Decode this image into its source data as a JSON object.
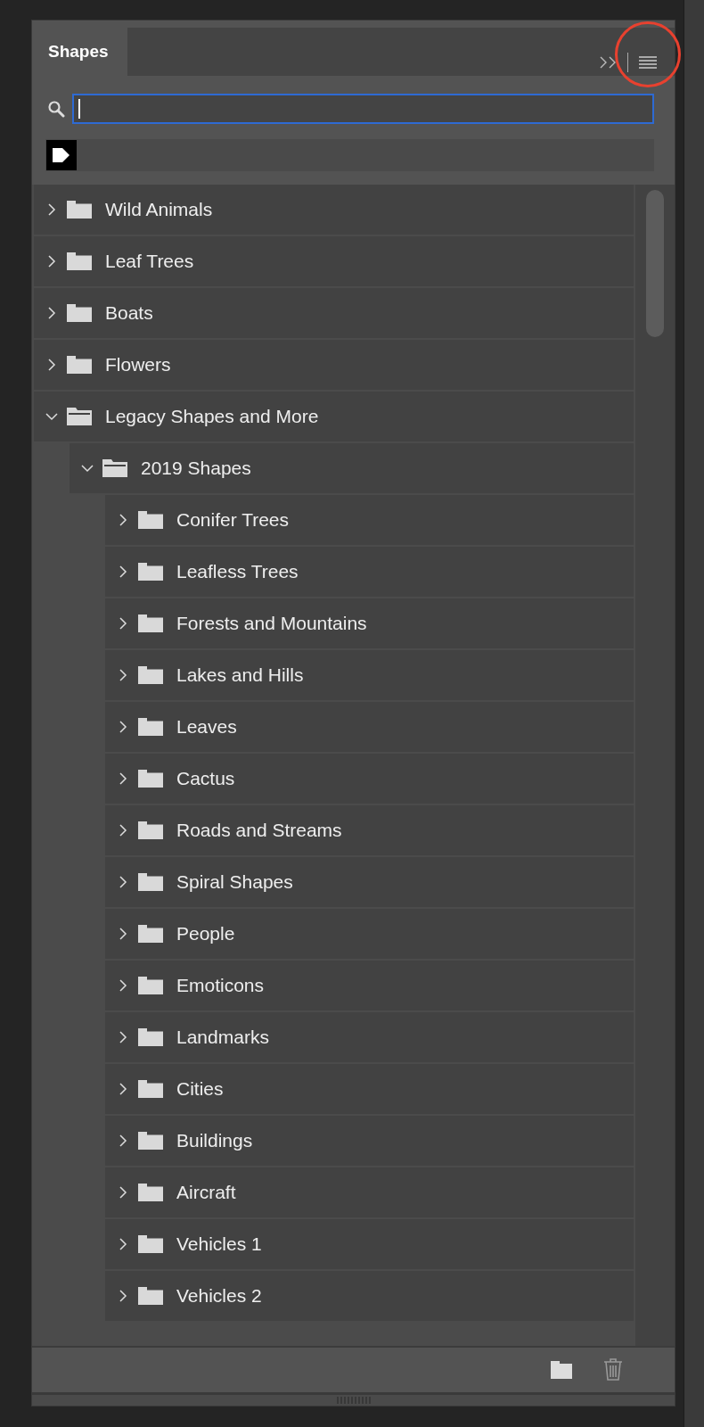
{
  "tabs": [
    {
      "label": "Shapes",
      "selected": true
    }
  ],
  "search": {
    "focused": true
  },
  "tree": [
    {
      "label": "Wild Animals",
      "expanded": false
    },
    {
      "label": "Leaf Trees",
      "expanded": false
    },
    {
      "label": "Boats",
      "expanded": false
    },
    {
      "label": "Flowers",
      "expanded": false
    },
    {
      "label": "Legacy Shapes and More",
      "expanded": true,
      "children": [
        {
          "label": "2019 Shapes",
          "expanded": true,
          "children": [
            {
              "label": "Conifer Trees",
              "expanded": false
            },
            {
              "label": "Leafless Trees",
              "expanded": false
            },
            {
              "label": "Forests and Mountains",
              "expanded": false
            },
            {
              "label": "Lakes and Hills",
              "expanded": false
            },
            {
              "label": "Leaves",
              "expanded": false
            },
            {
              "label": "Cactus",
              "expanded": false
            },
            {
              "label": "Roads and Streams",
              "expanded": false
            },
            {
              "label": "Spiral Shapes",
              "expanded": false
            },
            {
              "label": "People",
              "expanded": false
            },
            {
              "label": "Emoticons",
              "expanded": false
            },
            {
              "label": "Landmarks",
              "expanded": false
            },
            {
              "label": "Cities",
              "expanded": false
            },
            {
              "label": "Buildings",
              "expanded": false
            },
            {
              "label": "Aircraft",
              "expanded": false
            },
            {
              "label": "Vehicles 1",
              "expanded": false
            },
            {
              "label": "Vehicles 2",
              "expanded": false
            }
          ]
        }
      ]
    }
  ]
}
